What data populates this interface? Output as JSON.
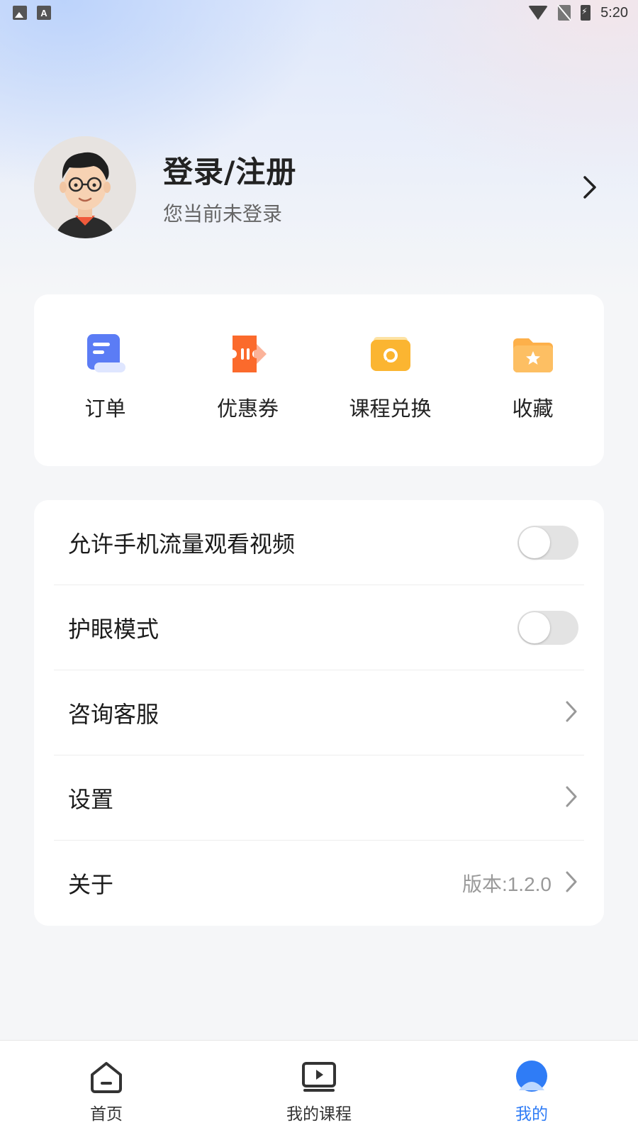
{
  "status_bar": {
    "time": "5:20",
    "left_icons": [
      "image-icon",
      "font-icon"
    ],
    "right_icons": [
      "wifi-icon",
      "no-sim-icon",
      "battery-charging-icon"
    ]
  },
  "profile": {
    "title": "登录/注册",
    "subtitle": "您当前未登录",
    "avatar": "avatar-illustration"
  },
  "quick_actions": [
    {
      "label": "订单",
      "icon": "order-icon",
      "color": "#5b7cf5"
    },
    {
      "label": "优惠券",
      "icon": "coupon-icon",
      "color": "#fb6a2c"
    },
    {
      "label": "课程兑换",
      "icon": "exchange-icon",
      "color": "#fbb531"
    },
    {
      "label": "收藏",
      "icon": "favorite-folder-icon",
      "color": "#fdb04a"
    }
  ],
  "settings": {
    "mobile_data_video": {
      "label": "允许手机流量观看视频",
      "enabled": false
    },
    "eye_care_mode": {
      "label": "护眼模式",
      "enabled": false
    },
    "customer_service": {
      "label": "咨询客服"
    },
    "settings": {
      "label": "设置"
    },
    "about": {
      "label": "关于",
      "value": "版本:1.2.0"
    }
  },
  "bottom_nav": {
    "items": [
      {
        "label": "首页",
        "icon": "home-icon"
      },
      {
        "label": "我的课程",
        "icon": "my-courses-icon"
      },
      {
        "label": "我的",
        "icon": "mine-icon"
      }
    ],
    "active": "我的",
    "active_color": "#2f7cf6"
  }
}
